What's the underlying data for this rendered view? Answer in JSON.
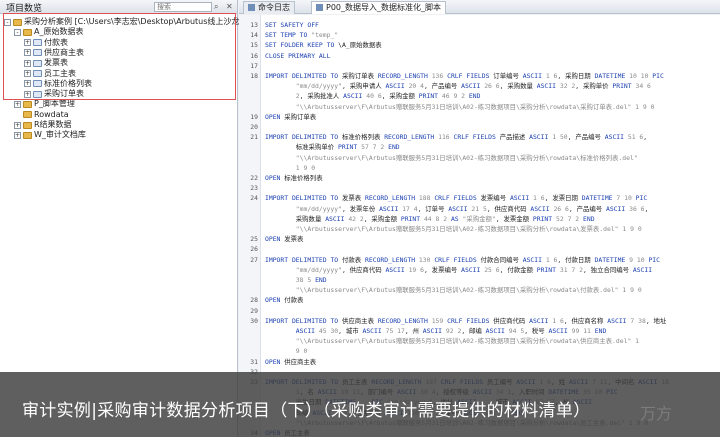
{
  "panel": {
    "title": "项目数览",
    "search_placeholder": "搜索"
  },
  "tree": [
    {
      "label": "采购分析案例 [C:\\Users\\李志宏\\Desktop\\Arbutus线上沙龙_采购审计",
      "indent": 0,
      "expander": "-",
      "icon": "folder"
    },
    {
      "label": "A_原始数据表",
      "indent": 1,
      "expander": "-",
      "icon": "folder"
    },
    {
      "label": "付款表",
      "indent": 2,
      "expander": "+",
      "icon": "table"
    },
    {
      "label": "供应商主表",
      "indent": 2,
      "expander": "+",
      "icon": "table"
    },
    {
      "label": "发票表",
      "indent": 2,
      "expander": "+",
      "icon": "table"
    },
    {
      "label": "员工主表",
      "indent": 2,
      "expander": "+",
      "icon": "table"
    },
    {
      "label": "标准价格列表",
      "indent": 2,
      "expander": "+",
      "icon": "table"
    },
    {
      "label": "采购订单表",
      "indent": 2,
      "expander": "+",
      "icon": "table"
    },
    {
      "label": "P_脚本管理",
      "indent": 1,
      "expander": "+",
      "icon": "folder"
    },
    {
      "label": "Rowdata",
      "indent": 1,
      "expander": "",
      "icon": "folder"
    },
    {
      "label": "R结果数据",
      "indent": 1,
      "expander": "+",
      "icon": "folder"
    },
    {
      "label": "W_审计文档库",
      "indent": 1,
      "expander": "+",
      "icon": "folder"
    }
  ],
  "tabs": [
    {
      "label": "命令日志",
      "active": false
    },
    {
      "label": "P00_数据导入_数据标准化_脚本",
      "active": true
    }
  ],
  "code_lines": [
    {
      "n": "13",
      "code": "SET SAFETY OFF"
    },
    {
      "n": "14",
      "code": "SET TEMP TO \"temp_\""
    },
    {
      "n": "15",
      "code": "SET FOLDER KEEP TO \\A_原始数据表"
    },
    {
      "n": "16",
      "code": "CLOSE PRIMARY ALL"
    },
    {
      "n": "17",
      "code": ""
    },
    {
      "n": "18",
      "code": "IMPORT DELIMITED TO 采购订单表 RECORD_LENGTH 136 CRLF FIELDS 订单编号 ASCII 1 6, 采购日期 DATETIME 10 10 PIC"
    },
    {
      "n": "",
      "code": "        \"mm/dd/yyyy\", 采购申请人 ASCII 20 4, 产品编号 ASCII 26 6, 采购数量 ASCII 32 2, 采购单价 PRINT 34 6"
    },
    {
      "n": "",
      "code": "        2, 采购批准人 ASCII 40 6, 采购金额 PRINT 46 9 2 END"
    },
    {
      "n": "",
      "code": "        \"\\\\Arbutusserver\\F\\Arbutus赠联服务5月31日培训\\A02-练习数据项目\\采购分析\\rowdata\\采购订单表.del\" 1 9 0"
    },
    {
      "n": "19",
      "code": "OPEN 采购订单表"
    },
    {
      "n": "20",
      "code": ""
    },
    {
      "n": "21",
      "code": "IMPORT DELIMITED TO 标准价格列表 RECORD_LENGTH 116 CRLF FIELDS 产品描述 ASCII 1 50, 产品编号 ASCII 51 6,"
    },
    {
      "n": "",
      "code": "        标准采购单价 PRINT 57 7 2 END"
    },
    {
      "n": "",
      "code": "        \"\\\\Arbutusserver\\F\\Arbutus赠联服务5月31日培训\\A02-练习数据项目\\采购分析\\rowdata\\标准价格列表.del\""
    },
    {
      "n": "",
      "code": "        1 9 0"
    },
    {
      "n": "22",
      "code": "OPEN 标准价格列表"
    },
    {
      "n": "23",
      "code": ""
    },
    {
      "n": "24",
      "code": "IMPORT DELIMITED TO 发票表 RECORD_LENGTH 188 CRLF FIELDS 发票编号 ASCII 1 6, 发票日期 DATETIME 7 10 PIC"
    },
    {
      "n": "",
      "code": "        \"mm/dd/yyyy\", 发票年份 ASCII 17 4, 订单号 ASCII 21 5, 供应商代码 ASCII 26 6, 产品编号 ASCII 36 6,"
    },
    {
      "n": "",
      "code": "        采购数量 ASCII 42 2, 采购金额 PRINT 44 8 2 AS \"采购金额\", 发票金额 PRINT 52 7 2 END"
    },
    {
      "n": "",
      "code": "        \"\\\\Arbutusserver\\F\\Arbutus赠联服务5月31日培训\\A02-练习数据项目\\采购分析\\rowdata\\发票表.del\" 1 9 0"
    },
    {
      "n": "25",
      "code": "OPEN 发票表"
    },
    {
      "n": "26",
      "code": ""
    },
    {
      "n": "27",
      "code": "IMPORT DELIMITED TO 付款表 RECORD_LENGTH 130 CRLF FIELDS 付款合同编号 ASCII 1 6, 付款日期 DATETIME 9 10 PIC"
    },
    {
      "n": "",
      "code": "        \"mm/dd/yyyy\", 供应商代码 ASCII 19 6, 发票编号 ASCII 25 6, 付款金额 PRINT 31 7 2, 独立合同编号 ASCII"
    },
    {
      "n": "",
      "code": "        38 5 END"
    },
    {
      "n": "",
      "code": "        \"\\\\Arbutusserver\\F\\Arbutus赠联服务5月31日培训\\A02-练习数据项目\\采购分析\\rowdata\\付款表.del\" 1 9 0"
    },
    {
      "n": "28",
      "code": "OPEN 付款表"
    },
    {
      "n": "29",
      "code": ""
    },
    {
      "n": "30",
      "code": "IMPORT DELIMITED TO 供应商主表 RECORD_LENGTH 159 CRLF FIELDS 供应商代码 ASCII 1 6, 供应商名称 ASCII 7 38, 地址"
    },
    {
      "n": "",
      "code": "        ASCII 45 30, 城市 ASCII 75 17, 州 ASCII 92 2, 邮编 ASCII 94 5, 税号 ASCII 99 11 END"
    },
    {
      "n": "",
      "code": "        \"\\\\Arbutusserver\\F\\Arbutus赠联服务5月31日培训\\A02-练习数据项目\\采购分析\\rowdata\\供应商主表.del\" 1"
    },
    {
      "n": "",
      "code": "        9 0"
    },
    {
      "n": "31",
      "code": "OPEN 供应商主表"
    },
    {
      "n": "32",
      "code": ""
    },
    {
      "n": "33",
      "code": "IMPORT DELIMITED TO 员工主表 RECORD_LENGTH 197 CRLF FIELDS 员工编号 ASCII 1 6, 姓 ASCII 7 11, 中间名 ASCII 18"
    },
    {
      "n": "",
      "code": "        1, 名 ASCII 19 11, 部门编号 ASCII 30 4, 授权等级 ASCII 34 1, 入职时间 DATETIME 35 10 PIC"
    },
    {
      "n": "",
      "code": "        出生日期 DATETIME    PIC \"mm/dd/yyyy\", 地址 ASCII     城市 ASCII 87 17, 州 ASCII"
    },
    {
      "n": "",
      "code": "        邮编 ASCII 3 6, 电话号码 ASCII 110 12, 社保号 ASCII 121 11 END"
    },
    {
      "n": "",
      "code": "        \"\\\\Arbutusserver\\F\\Arbutus赠联服务5月31日培训\\A02-练习数据项目\\采购分析\\rowdata\\员工主表.del\" 1 9 0"
    },
    {
      "n": "34",
      "code": "OPEN 员工主表"
    }
  ],
  "caption": "审计实例|采购审计数据分析项目（下）（采购类审计需要提供的材料清单）",
  "watermark": "万方",
  "colors": {
    "keyword": "#1a3fb0",
    "string": "#8a8a8a",
    "highlight_border": "#e05050"
  }
}
